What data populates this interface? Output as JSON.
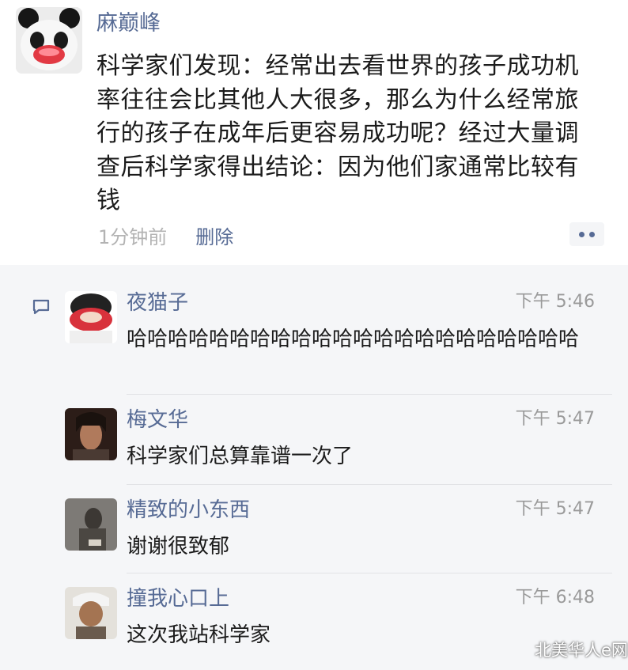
{
  "post": {
    "author": "麻巅峰",
    "text": "科学家们发现：经常出去看世界的孩子成功机率往往会比其他人大很多，那么为什么经常旅行的孩子在成年后更容易成功呢？经过大量调查后科学家得出结论：因为他们家通常比较有钱",
    "time": "1分钟前",
    "delete_label": "删除"
  },
  "comments": [
    {
      "name": "夜猫子",
      "time": "下午 5:46",
      "text": "哈哈哈哈哈哈哈哈哈哈哈哈哈哈哈哈哈哈哈哈哈哈"
    },
    {
      "name": "梅文华",
      "time": "下午 5:47",
      "text": "科学家们总算靠谱一次了"
    },
    {
      "name": "精致的小东西",
      "time": "下午 5:47",
      "text": "谢谢很致郁"
    },
    {
      "name": "撞我心口上",
      "time": "下午 6:48",
      "text": "这次我站科学家"
    }
  ],
  "watermark": "北美华人e网",
  "colors": {
    "link": "#576b95",
    "panel": "#f5f6f8"
  }
}
